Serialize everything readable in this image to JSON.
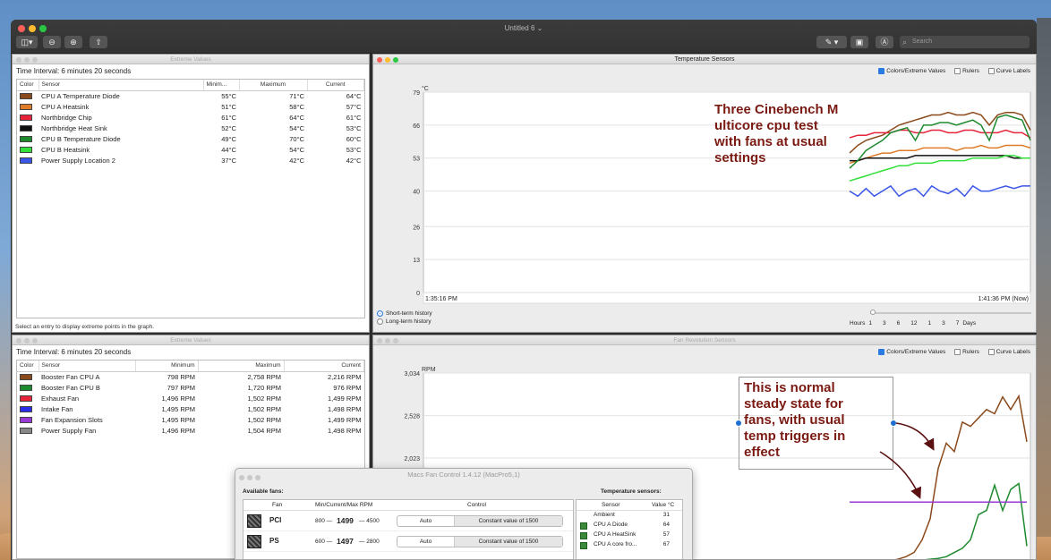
{
  "app": {
    "window_title": "Untitled 6 ⌄",
    "search_placeholder": "Search"
  },
  "top_left": {
    "title": "Extreme Values",
    "interval": "Time Interval: 6 minutes 20 seconds",
    "columns": [
      "Color",
      "Sensor",
      "Minim...",
      "Maximum",
      "Current"
    ],
    "rows": [
      {
        "color": "#8b4a1c",
        "name": "CPU A Temperature Diode",
        "min": "55°C",
        "max": "71°C",
        "cur": "64°C"
      },
      {
        "color": "#e07b27",
        "name": "CPU A Heatsink",
        "min": "51°C",
        "max": "58°C",
        "cur": "57°C"
      },
      {
        "color": "#e8243a",
        "name": "Northbridge Chip",
        "min": "61°C",
        "max": "64°C",
        "cur": "61°C"
      },
      {
        "color": "#111111",
        "name": "Northbridge Heat Sink",
        "min": "52°C",
        "max": "54°C",
        "cur": "53°C"
      },
      {
        "color": "#1e8a2e",
        "name": "CPU B Temperature Diode",
        "min": "49°C",
        "max": "70°C",
        "cur": "60°C"
      },
      {
        "color": "#33e03a",
        "name": "CPU B Heatsink",
        "min": "44°C",
        "max": "54°C",
        "cur": "53°C"
      },
      {
        "color": "#3a56e8",
        "name": "Power Supply Location 2",
        "min": "37°C",
        "max": "42°C",
        "cur": "42°C"
      }
    ],
    "footnote": "Select an entry to display extreme points in the graph."
  },
  "bottom_left": {
    "title": "Extreme Values",
    "interval": "Time Interval: 6 minutes 20 seconds",
    "columns": [
      "Color",
      "Sensor",
      "Minimum",
      "Maximum",
      "Current"
    ],
    "rows": [
      {
        "color": "#8b4a1c",
        "name": "Booster Fan CPU A",
        "min": "798 RPM",
        "max": "2,758 RPM",
        "cur": "2,216 RPM"
      },
      {
        "color": "#1e8a2e",
        "name": "Booster Fan CPU B",
        "min": "797 RPM",
        "max": "1,720 RPM",
        "cur": "976 RPM"
      },
      {
        "color": "#e8243a",
        "name": "Exhaust Fan",
        "min": "1,496 RPM",
        "max": "1,502 RPM",
        "cur": "1,499 RPM"
      },
      {
        "color": "#2a2ee8",
        "name": "Intake Fan",
        "min": "1,495 RPM",
        "max": "1,502 RPM",
        "cur": "1,498 RPM"
      },
      {
        "color": "#9a3ad6",
        "name": "Fan Expansion Slots",
        "min": "1,495 RPM",
        "max": "1,502 RPM",
        "cur": "1,499 RPM"
      },
      {
        "color": "#888888",
        "name": "Power Supply Fan",
        "min": "1,496 RPM",
        "max": "1,504 RPM",
        "cur": "1,498 RPM"
      }
    ]
  },
  "temp_panel": {
    "title": "Temperature Sensors",
    "options": [
      "Colors/Extreme Values",
      "Rulers",
      "Curve Labels"
    ],
    "annotation": [
      "Three Cinebench M",
      "ulticore cpu test",
      "with fans at usual",
      "settings"
    ],
    "history_options": [
      "Short-term history",
      "Long-term history"
    ],
    "scale_label": "Hours",
    "scale_ticks": [
      "1",
      "3",
      "6",
      "12",
      "1",
      "3",
      "7"
    ],
    "scale_suffix": "Days"
  },
  "fan_panel": {
    "title": "Fan Revolution Sensors",
    "options": [
      "Colors/Extreme Values",
      "Rulers",
      "Curve Labels"
    ],
    "annotation": [
      "This is normal",
      "steady state for",
      "fans, with usual",
      "temp triggers in",
      "effect"
    ]
  },
  "mfc": {
    "title": "Macs Fan Control 1.4.12 (MacPro5,1)",
    "available_fans_label": "Available fans:",
    "temp_sensors_label": "Temperature sensors:",
    "fan_headers": [
      "Fan",
      "Min/Current/Max RPM",
      "Control"
    ],
    "fans": [
      {
        "name": "PCI",
        "min": "800 —",
        "current": "1499",
        "max": "— 4500",
        "mode": "Auto",
        "control": "Constant value of 1500"
      },
      {
        "name": "PS",
        "min": "600 —",
        "current": "1497",
        "max": "— 2800",
        "mode": "Auto",
        "control": "Constant value of 1500"
      }
    ],
    "sensor_headers": [
      "Sensor",
      "Value °C"
    ],
    "sensors": [
      {
        "name": "Ambient",
        "value": "31",
        "chip": false
      },
      {
        "name": "CPU A Diode",
        "value": "64",
        "chip": true
      },
      {
        "name": "CPU A HeatSink",
        "value": "57",
        "chip": true
      },
      {
        "name": "CPU A core fro...",
        "value": "67",
        "chip": true
      }
    ]
  },
  "chart_data": [
    {
      "type": "line",
      "title": "Temperature Sensors",
      "ylabel": "°C",
      "yticks": [
        0,
        13,
        26,
        40,
        53,
        66,
        79
      ],
      "ylim": [
        0,
        79
      ],
      "x_start_label": "1:35:16 PM",
      "x_end_label": "1:41:36 PM (Now)",
      "grid": true,
      "series": [
        {
          "name": "CPU A Temperature Diode",
          "color": "#8b4a1c",
          "values": [
            55,
            58,
            60,
            61,
            62,
            64,
            66,
            67,
            68,
            69,
            70,
            70,
            71,
            70,
            70,
            71,
            70,
            66,
            70,
            71,
            71,
            70,
            64
          ]
        },
        {
          "name": "CPU A Heatsink",
          "color": "#e07b27",
          "values": [
            51,
            52,
            53,
            54,
            55,
            55,
            56,
            56,
            56,
            57,
            57,
            57,
            57,
            56,
            57,
            57,
            58,
            57,
            57,
            58,
            58,
            58,
            57
          ]
        },
        {
          "name": "Northbridge Chip",
          "color": "#e8243a",
          "values": [
            61,
            62,
            62,
            63,
            63,
            63,
            64,
            64,
            63,
            63,
            64,
            64,
            63,
            63,
            64,
            64,
            63,
            63,
            63,
            64,
            63,
            63,
            61
          ]
        },
        {
          "name": "Northbridge Heat Sink",
          "color": "#111111",
          "values": [
            52,
            52,
            53,
            53,
            53,
            53,
            53,
            53,
            54,
            54,
            54,
            54,
            54,
            54,
            54,
            54,
            54,
            54,
            54,
            54,
            53,
            53,
            53
          ]
        },
        {
          "name": "CPU B Temperature Diode",
          "color": "#1e8a2e",
          "values": [
            49,
            52,
            56,
            58,
            60,
            63,
            64,
            65,
            60,
            66,
            66,
            67,
            67,
            66,
            67,
            68,
            66,
            60,
            69,
            70,
            69,
            68,
            60
          ]
        },
        {
          "name": "CPU B Heatsink",
          "color": "#33e03a",
          "values": [
            44,
            45,
            46,
            47,
            48,
            49,
            50,
            50,
            51,
            51,
            51,
            52,
            52,
            52,
            52,
            53,
            53,
            53,
            53,
            54,
            54,
            53,
            53
          ]
        },
        {
          "name": "Power Supply Location 2",
          "color": "#3a56e8",
          "values": [
            40,
            38,
            41,
            38,
            40,
            42,
            38,
            40,
            41,
            38,
            42,
            40,
            39,
            41,
            38,
            42,
            40,
            40,
            41,
            42,
            41,
            42,
            42
          ]
        }
      ]
    },
    {
      "type": "line",
      "title": "Fan Revolution Sensors",
      "ylabel": "RPM",
      "yticks": [
        2023,
        2528,
        3034
      ],
      "ylim": [
        800,
        3034
      ],
      "grid": true,
      "series": [
        {
          "name": "Booster Fan CPU A",
          "color": "#8b4a1c",
          "values": [
            800,
            800,
            800,
            800,
            800,
            800,
            820,
            850,
            900,
            1050,
            1300,
            1900,
            2200,
            2100,
            2450,
            2400,
            2500,
            2600,
            2550,
            2750,
            2600,
            2758,
            2216
          ]
        },
        {
          "name": "Booster Fan CPU B",
          "color": "#1e8a2e",
          "values": [
            800,
            800,
            800,
            800,
            800,
            800,
            800,
            800,
            800,
            810,
            820,
            830,
            850,
            900,
            950,
            1050,
            1350,
            1400,
            1700,
            1400,
            1650,
            1720,
            976
          ]
        },
        {
          "name": "Fan Expansion Slots",
          "color": "#9a3ad6",
          "values": [
            1499,
            1499,
            1499,
            1499,
            1499,
            1499,
            1499,
            1499,
            1499,
            1499,
            1499,
            1499,
            1499,
            1499,
            1499,
            1499,
            1499,
            1499,
            1499,
            1499,
            1499,
            1499,
            1499
          ]
        }
      ]
    }
  ]
}
